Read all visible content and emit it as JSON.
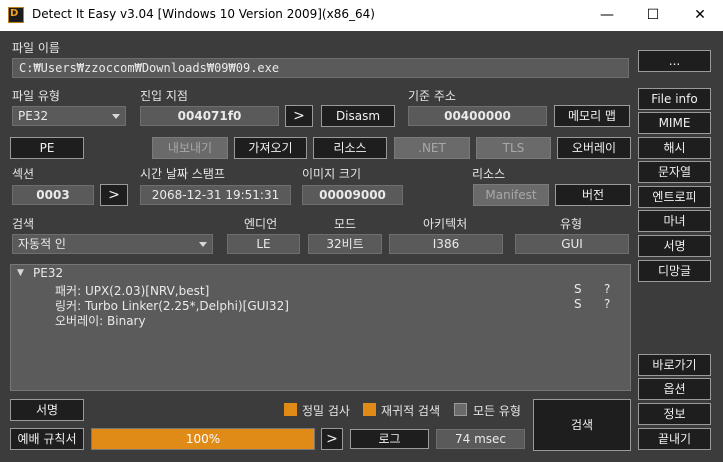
{
  "window": {
    "title": "Detect It Easy v3.04 [Windows 10 Version 2009](x86_64)",
    "icon_label": "D",
    "minimize_glyph": "—",
    "maximize_glyph": "☐",
    "close_glyph": "✕"
  },
  "file": {
    "name_label": "파일 이름",
    "path": "C:₩Users₩zzoccom₩Downloads₩09₩09.exe",
    "browse_label": "..."
  },
  "info": {
    "file_type_label": "파일 유형",
    "file_type_value": "PE32",
    "entry_point_label": "진입 지점",
    "entry_point_value": "004071f0",
    "entry_arrow": ">",
    "disasm_label": "Disasm",
    "base_address_label": "기준 주소",
    "base_address_value": "00400000",
    "memory_map_label": "메모리 맵"
  },
  "row_buttons": {
    "pe": "PE",
    "export": "내보내기",
    "import": "가져오기",
    "resources": "리소스",
    "net": ".NET",
    "tls": "TLS",
    "overlay": "오버레이"
  },
  "sections": {
    "sections_label": "섹션",
    "sections_value": "0003",
    "sections_arrow": ">",
    "timestamp_label": "시간 날짜 스탬프",
    "timestamp_value": "2068-12-31 19:51:31",
    "image_size_label": "이미지 크기",
    "image_size_value": "00009000",
    "resources_label": "리소스",
    "manifest_label": "Manifest",
    "version_label": "버전"
  },
  "scan": {
    "scan_label": "검색",
    "scan_mode_value": "자동적 인",
    "endian_label": "엔디언",
    "endian_value": "LE",
    "mode_label": "모드",
    "mode_value": "32비트",
    "arch_label": "아키텍처",
    "arch_value": "I386",
    "type_label": "유형",
    "type_value": "GUI"
  },
  "sidebar": {
    "file_info": "File info",
    "mime": "MIME",
    "hash": "해시",
    "strings": "문자열",
    "entropy": "엔트로피",
    "hex": "마녀",
    "signature": "서명",
    "demangle": "디망글",
    "shortcuts": "바로가기",
    "options": "옵션",
    "about": "정보",
    "exit": "끝내기"
  },
  "results": {
    "toggle_glyph": "▼",
    "root": "PE32",
    "rows": [
      {
        "text": "패커: UPX(2.03)[NRV,best]",
        "s": "S",
        "q": "?"
      },
      {
        "text": "링커: Turbo Linker(2.25*,Delphi)[GUI32]",
        "s": "S",
        "q": "?"
      },
      {
        "text": "오버레이: Binary",
        "s": "",
        "q": ""
      }
    ]
  },
  "bottom": {
    "signatures_label": "서명",
    "rules_label": "예배 규칙서",
    "progress_text": "100%",
    "progress_fraction": 1.0,
    "progress_arrow": ">",
    "log_label": "로그",
    "time_value": "74 msec",
    "deep_scan_label": "정밀 검사",
    "deep_scan_checked": true,
    "recursive_label": "재귀적 검색",
    "recursive_checked": true,
    "all_types_label": "모든 유형",
    "all_types_checked": false,
    "scan_button": "검색"
  },
  "colors": {
    "accent": "#e08a18",
    "background": "#3c3c3c",
    "field": "#5a5a5a",
    "button": "#1e1e1e"
  }
}
